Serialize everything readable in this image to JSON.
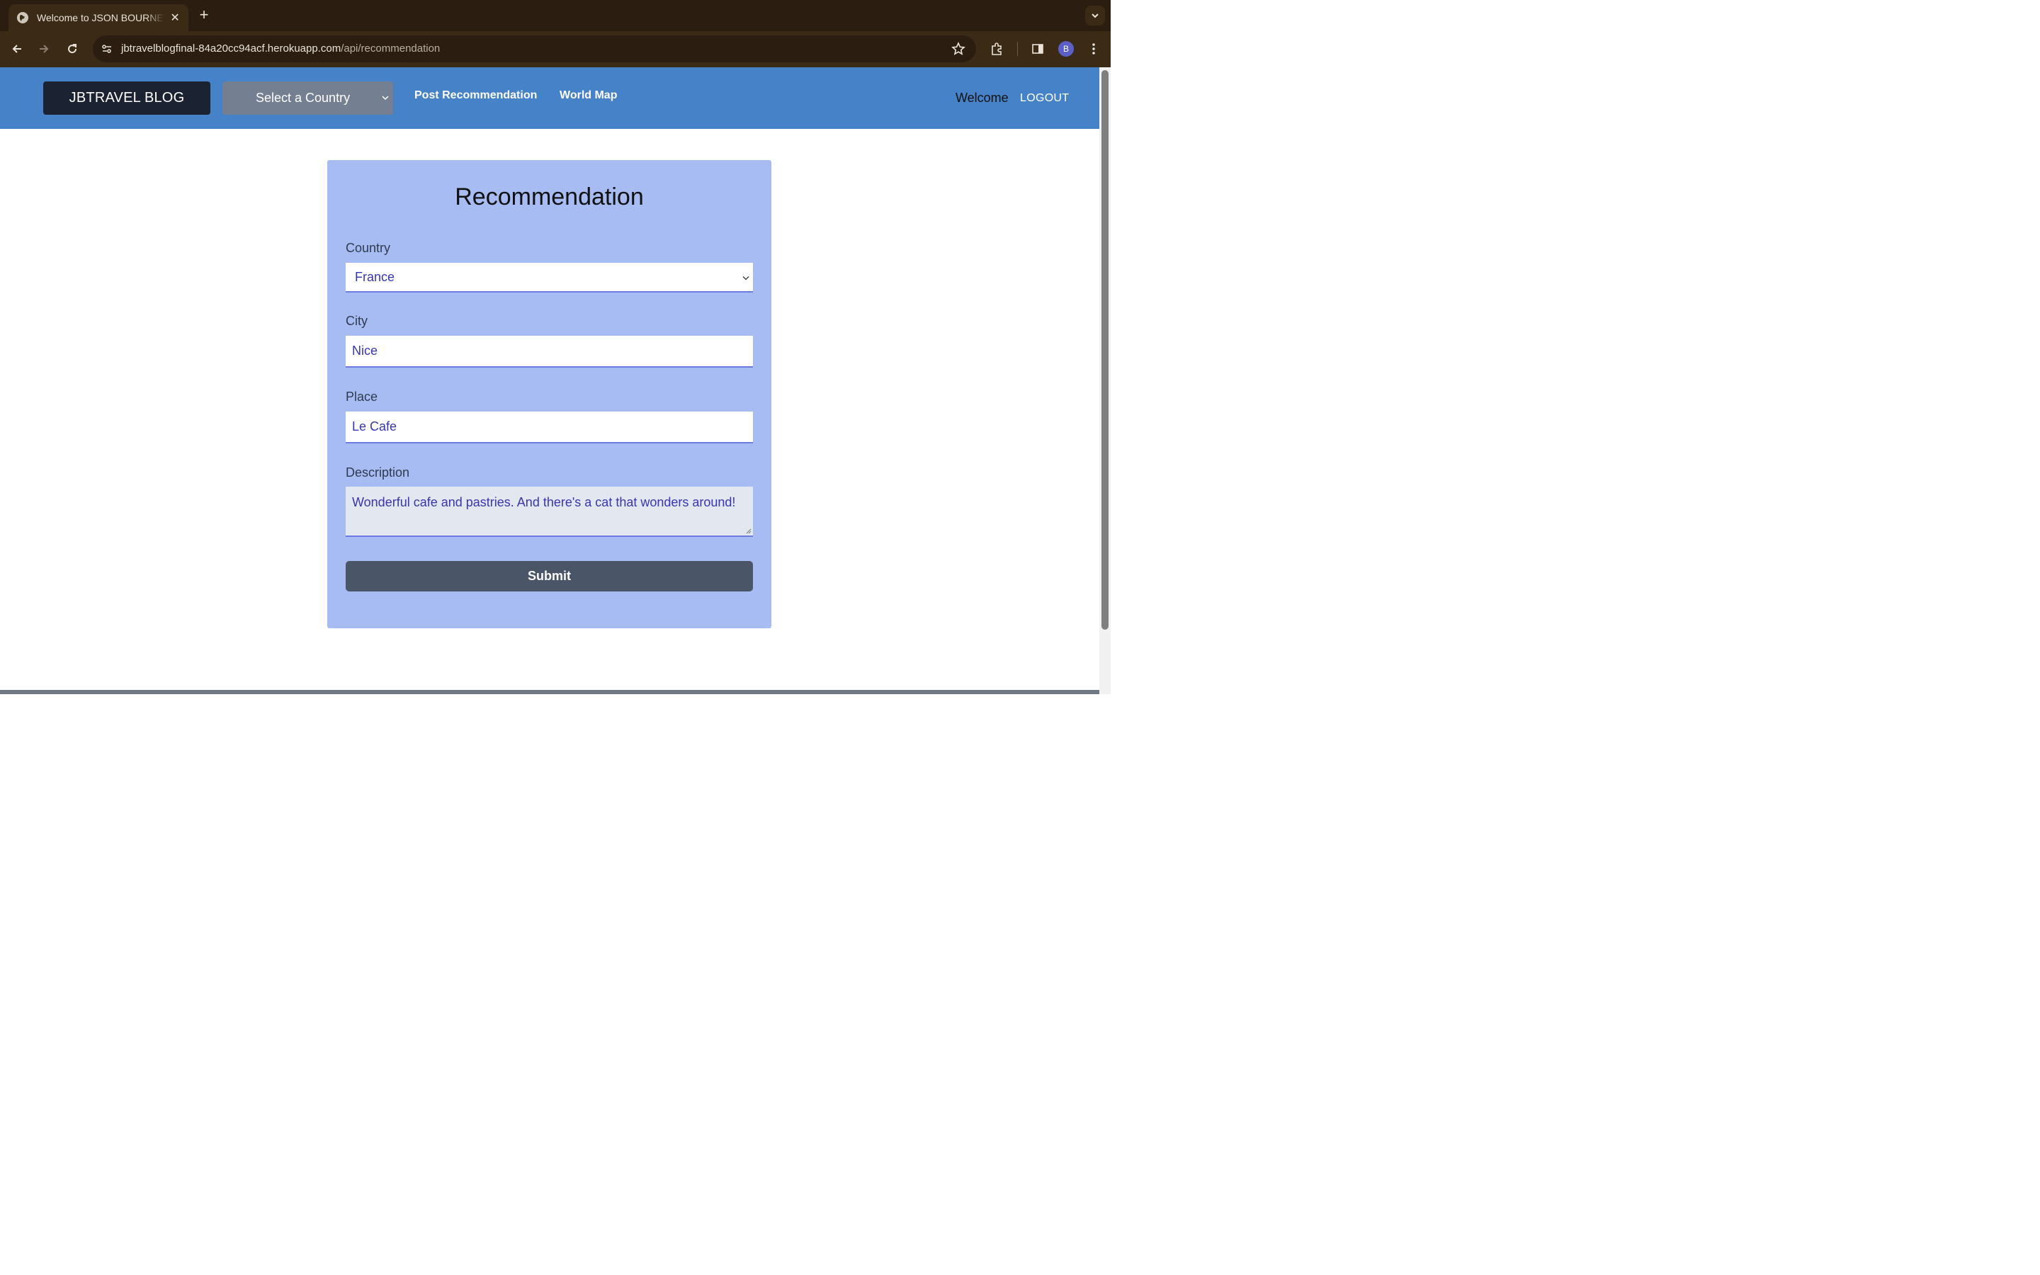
{
  "browser": {
    "tab_title": "Welcome to JSON BOURNE'S",
    "tab_close": "✕",
    "new_tab": "+",
    "url_host": "jbtravelblogfinal-84a20cc94acf.herokuapp.com",
    "url_path": "/api/recommendation",
    "profile_initial": "B"
  },
  "navbar": {
    "brand": "JBTRAVEL BLOG",
    "country_select": "Select a Country",
    "links": [
      "Post Recommendation",
      "World Map"
    ],
    "welcome": "Welcome",
    "logout": "LOGOUT"
  },
  "form": {
    "title": "Recommendation",
    "country_label": "Country",
    "country_value": "France",
    "city_label": "City",
    "city_value": "Nice",
    "place_label": "Place",
    "place_value": "Le Cafe",
    "description_label": "Description",
    "description_value": "Wonderful cafe and pastries. And there's a cat that wonders around!",
    "submit": "Submit"
  },
  "colors": {
    "navbar_bg": "#4682c8",
    "card_bg": "#a8bcf4",
    "brand_bg": "#1b2231",
    "submit_bg": "#4a5568",
    "input_text": "#3637b0"
  }
}
